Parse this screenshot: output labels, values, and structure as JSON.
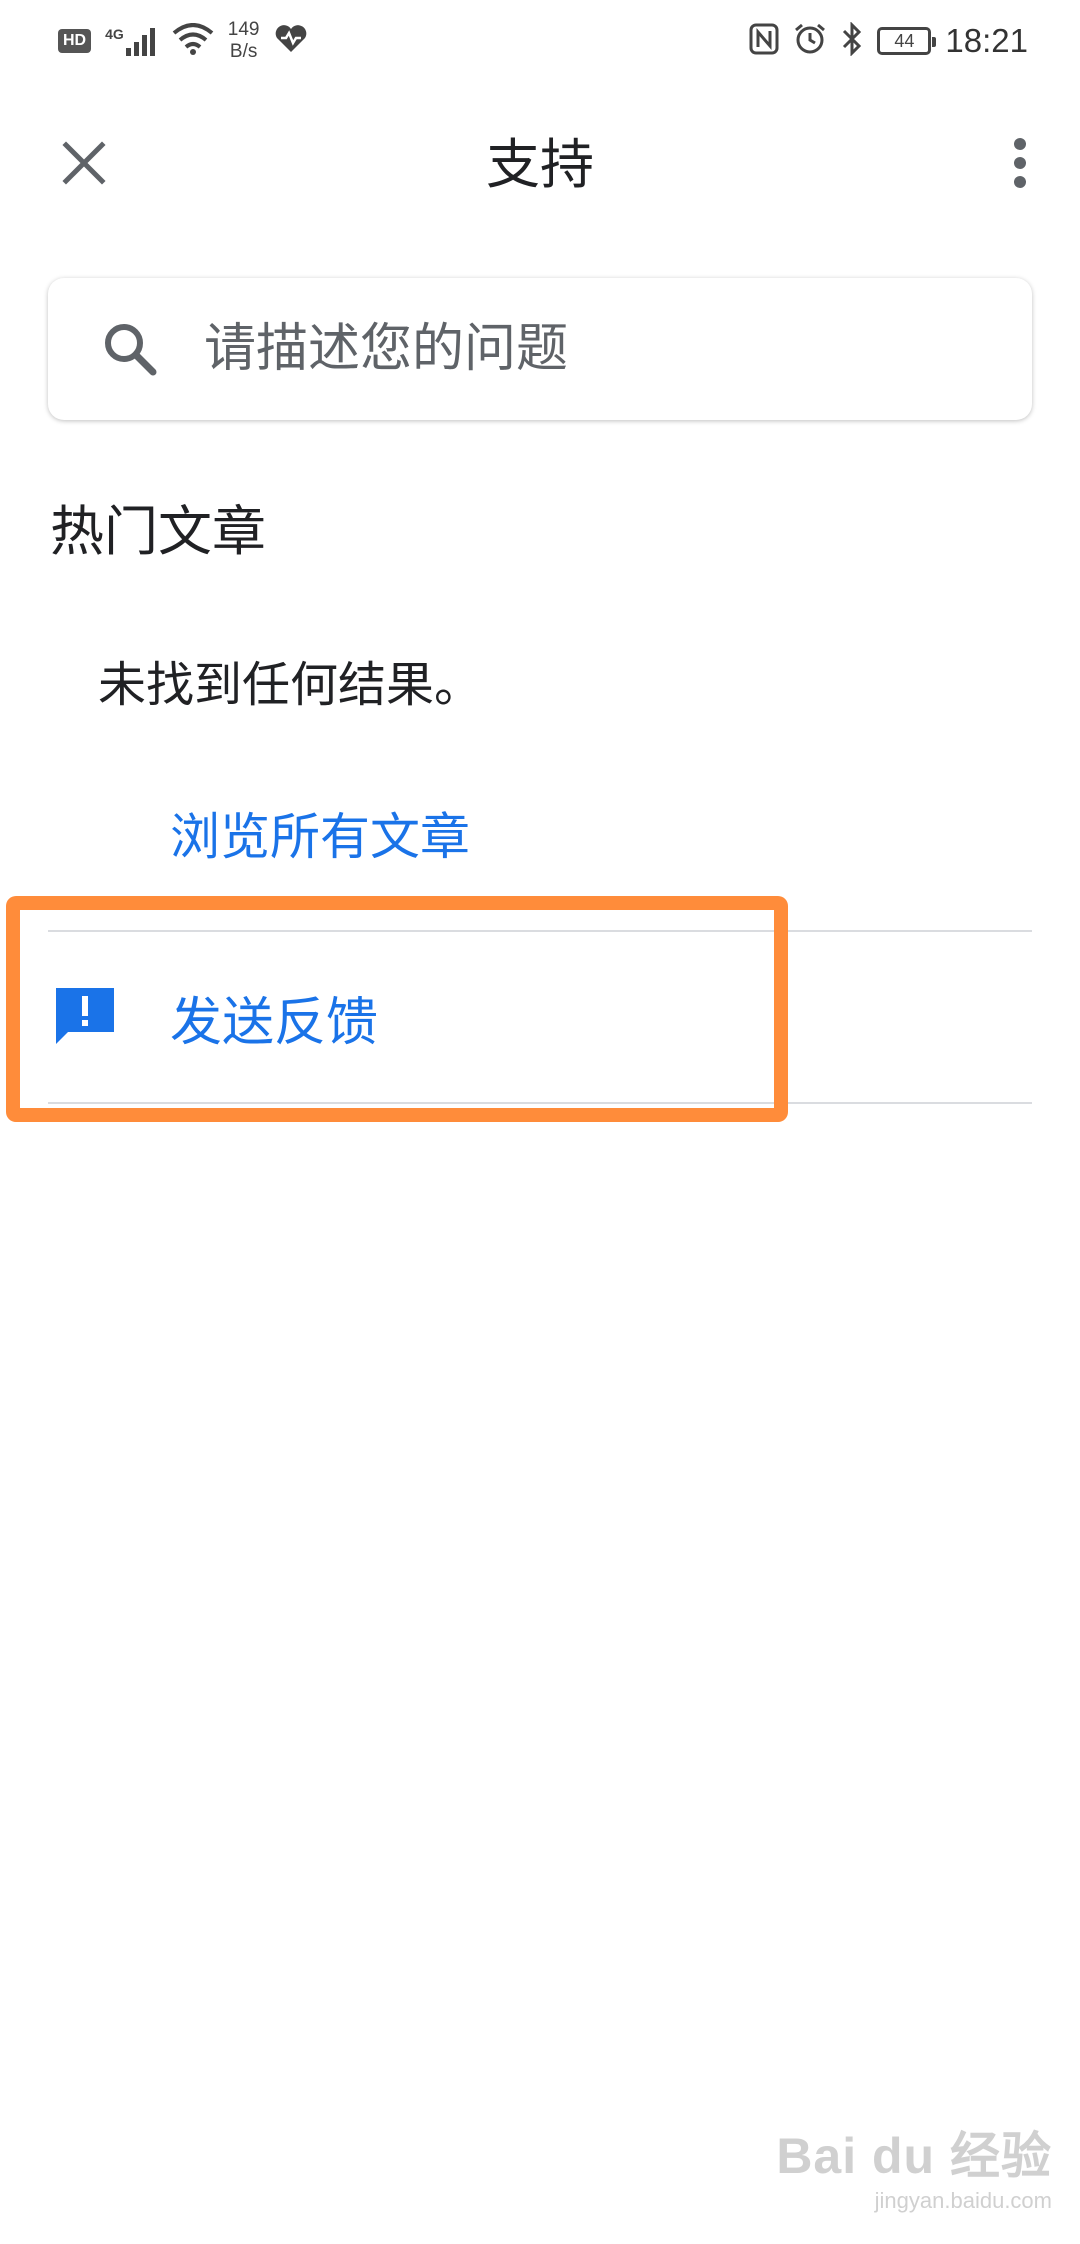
{
  "status_bar": {
    "hd": "HD",
    "network": "4G",
    "speed_value": "149",
    "speed_unit": "B/s",
    "battery": "44",
    "time": "18:21"
  },
  "app_bar": {
    "title": "支持",
    "close_icon": "close-icon",
    "more_icon": "more-vert-icon"
  },
  "search": {
    "placeholder": "请描述您的问题",
    "icon": "search-icon"
  },
  "popular": {
    "title": "热门文章",
    "empty_message": "未找到任何结果。",
    "browse_all": "浏览所有文章"
  },
  "feedback": {
    "label": "发送反馈",
    "icon": "feedback-icon"
  },
  "watermark": {
    "brand": "Bai du 经验",
    "url": "jingyan.baidu.com"
  },
  "colors": {
    "link": "#1a73e8",
    "highlight": "#ff8c3a",
    "divider": "#dadce0",
    "text": "#202124"
  }
}
